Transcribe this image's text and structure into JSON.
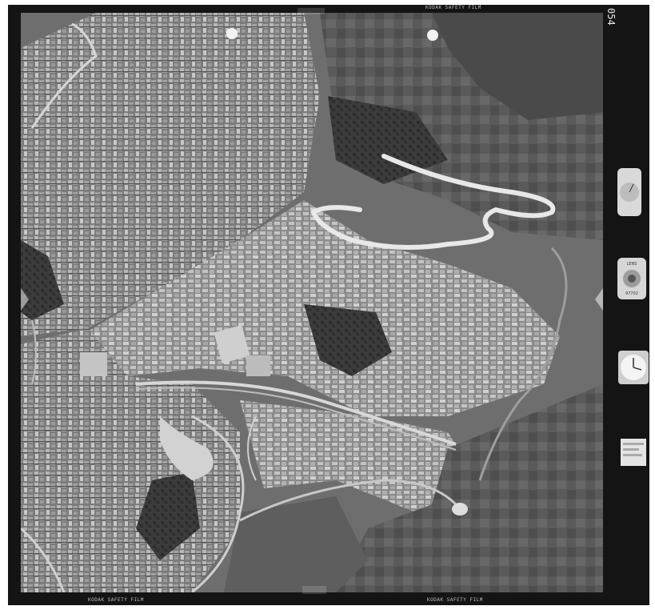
{
  "film": {
    "edge_marking": "KODAK SAFETY FILM",
    "frame_number": "054"
  },
  "instruments": {
    "altimeter_dial": "altimeter-icon",
    "lens_badge_top": "LENS",
    "lens_badge_bottom": "97702",
    "clock_dial": "clock-icon",
    "data_card": "data-card-icon"
  },
  "colors": {
    "film_border": "#141414",
    "dark_vegetation": "#3a3a3a",
    "urban_fabric": "#8c8c8c",
    "roads": "#e6e6e6"
  }
}
